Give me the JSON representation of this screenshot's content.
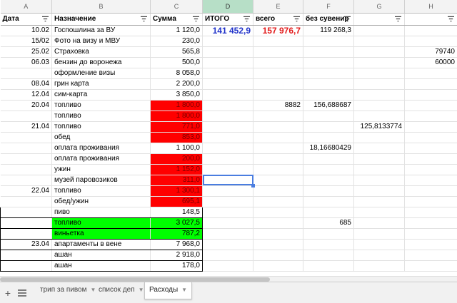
{
  "columns": [
    "A",
    "B",
    "C",
    "D",
    "E",
    "F",
    "G",
    "H"
  ],
  "active_column": "D",
  "header": {
    "a": "Дата",
    "b": "Назначение",
    "c": "Сумма",
    "d": "ИТОГО",
    "e": "всего",
    "f": "без сувенир",
    "g": "",
    "h": ""
  },
  "summary": {
    "itogo": "141 452,9",
    "vsego": "157 976,7",
    "bez_suvenir": "119 268,3"
  },
  "rows": [
    {
      "a": "10.02",
      "b": "Госпошлина за ВУ",
      "c": "1 120,0"
    },
    {
      "a": "15/02",
      "b": "Фото на визу и МВУ",
      "c": "230,0"
    },
    {
      "a": "25.02",
      "b": "Страховка",
      "c": "565,8",
      "h": "79740"
    },
    {
      "a": "06.03",
      "b": "бензин до воронежа",
      "c": "500,0",
      "h": "60000"
    },
    {
      "a": "",
      "b": "оформление визы",
      "c": "8 058,0"
    },
    {
      "a": "08.04",
      "b": "грин карта",
      "c": "2 200,0"
    },
    {
      "a": "12.04",
      "b": "сим-карта",
      "c": "3 850,0"
    },
    {
      "a": "20.04",
      "b": "топливо",
      "c": "1 800,0",
      "e": "8882",
      "f": "156,688687"
    },
    {
      "a": "",
      "b": "топливо",
      "c": "1 800,0"
    },
    {
      "a": "21.04",
      "b": "топливо",
      "c": "771,0",
      "g": "125,8133774"
    },
    {
      "a": "",
      "b": "обед",
      "c": "853,0"
    },
    {
      "a": "",
      "b": "оплата проживания",
      "c": "1 100,0",
      "f": "18,16680429"
    },
    {
      "a": "",
      "b": "оплата проживания",
      "c": "200,0"
    },
    {
      "a": "",
      "b": "ужин",
      "c": "1 152,0"
    },
    {
      "a": "",
      "b": "музей паровозиков",
      "c": "311,0"
    },
    {
      "a": "22.04",
      "b": "топливо",
      "c": "1 300,1"
    },
    {
      "a": "",
      "b": "обед/ужин",
      "c": "695,1"
    },
    {
      "a": "",
      "b": "пиво",
      "c": "148,5"
    },
    {
      "a": "",
      "b": "топливо",
      "c": "3 027,5",
      "f": "685"
    },
    {
      "a": "",
      "b": "виньетка",
      "c": "787,2"
    },
    {
      "a": "23.04",
      "b": "апартаменты в вене",
      "c": "7 968,0"
    },
    {
      "a": "",
      "b": "ашан",
      "c": "2 918,0"
    },
    {
      "a": "",
      "b": "ашан",
      "c": "178,0"
    }
  ],
  "tabs": [
    {
      "label": "трип за пивом"
    },
    {
      "label": "список деп"
    },
    {
      "label": "Расходы"
    }
  ],
  "colors": {
    "red_fill": "#ff0000",
    "green_fill": "#00ff00",
    "itogo_text": "#1f31c9",
    "vsego_text": "#e21a1a",
    "selection": "#4a7de0"
  }
}
